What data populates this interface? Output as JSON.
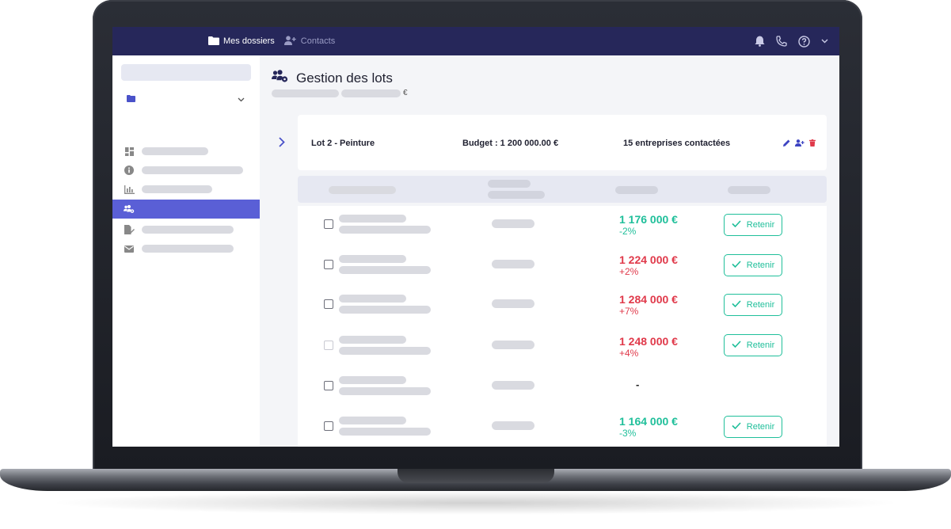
{
  "topbar": {
    "nav": [
      {
        "label": "Mes dossiers",
        "icon": "folder-icon"
      },
      {
        "label": "Contacts",
        "icon": "add-user-icon"
      }
    ],
    "icons": [
      "bell-icon",
      "phone-icon",
      "help-icon",
      "chevron-down-icon"
    ]
  },
  "sidebar": {
    "items": [
      {
        "icon": "dashboard-icon"
      },
      {
        "icon": "info-icon"
      },
      {
        "icon": "chart-icon"
      },
      {
        "icon": "users-gear-icon",
        "active": true
      },
      {
        "icon": "edit-document-icon"
      },
      {
        "icon": "mail-icon"
      }
    ]
  },
  "page": {
    "title": "Gestion des lots",
    "currency": "€"
  },
  "lot": {
    "name": "Lot 2 - Peinture",
    "budget": "Budget :  1 200 000.00 €",
    "contacts": "15 entreprises contactées"
  },
  "offers": [
    {
      "price": "1 176 000 €",
      "delta": "-2%",
      "status": "pos",
      "action": "Retenir"
    },
    {
      "price": "1 224 000 €",
      "delta": "+2%",
      "status": "neg",
      "action": "Retenir"
    },
    {
      "price": "1 284 000 €",
      "delta": "+7%",
      "status": "neg",
      "action": "Retenir"
    },
    {
      "price": "1 248 000 €",
      "delta": "+4%",
      "status": "neg",
      "action": "Retenir"
    },
    {
      "price": "-",
      "delta": "",
      "status": "none",
      "action": ""
    },
    {
      "price": "1 164 000 €",
      "delta": "-3%",
      "status": "pos",
      "action": "Retenir"
    }
  ],
  "colors": {
    "topbar": "#26275a",
    "accent": "#5a5fd6",
    "positive": "#1fbf9a",
    "negative": "#e0394a"
  }
}
